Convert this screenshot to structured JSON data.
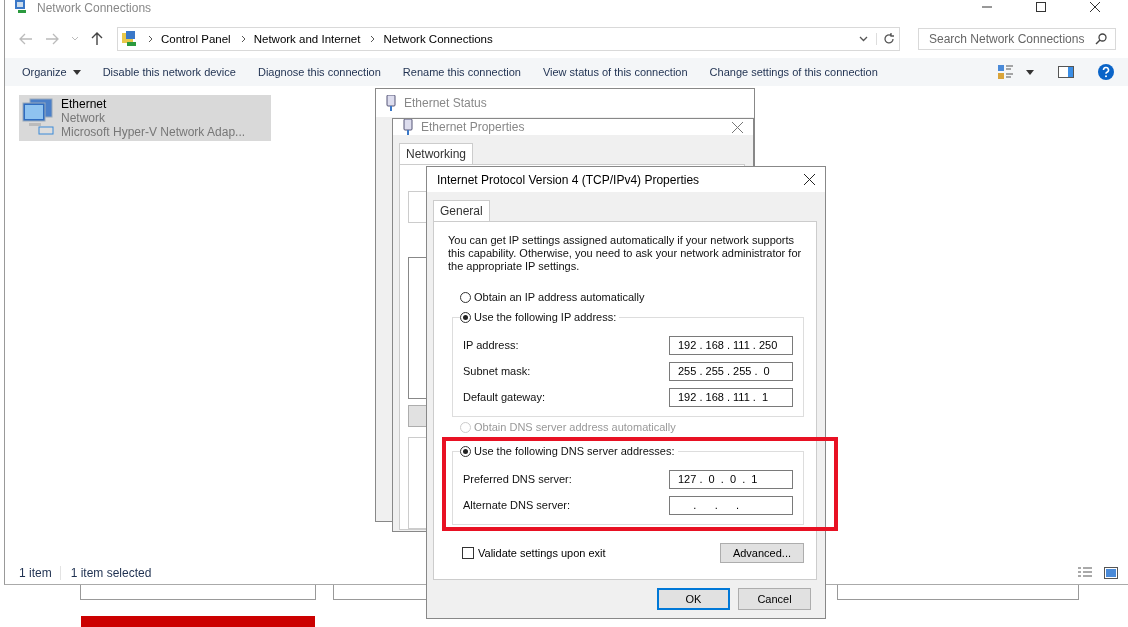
{
  "window": {
    "title": "Network Connections"
  },
  "address_bar": {
    "path": [
      "Control Panel",
      "Network and Internet",
      "Network Connections"
    ]
  },
  "search": {
    "placeholder": "Search Network Connections"
  },
  "toolbar": [
    {
      "label": "Organize",
      "dropdown": true
    },
    {
      "label": "Disable this network device",
      "dropdown": false
    },
    {
      "label": "Diagnose this connection",
      "dropdown": false
    },
    {
      "label": "Rename this connection",
      "dropdown": false
    },
    {
      "label": "View status of this connection",
      "dropdown": false
    },
    {
      "label": "Change settings of this connection",
      "dropdown": false
    }
  ],
  "connections": [
    {
      "name": "Ethernet",
      "network": "Network",
      "adapter": "Microsoft Hyper-V Network Adap...",
      "selected": true
    }
  ],
  "status_bar": {
    "count": "1 item",
    "selection": "1 item selected"
  },
  "status_dialog": {
    "title": "Ethernet Status"
  },
  "properties_dialog": {
    "title": "Ethernet Properties",
    "tabs": [
      {
        "label": "Networking",
        "selected": true
      }
    ]
  },
  "ipv4_dialog": {
    "title": "Internet Protocol Version 4 (TCP/IPv4) Properties",
    "tabs": [
      {
        "label": "General",
        "selected": true
      }
    ],
    "intro": "You can get IP settings assigned automatically if your network supports this capability. Otherwise, you need to ask your network administrator for the appropriate IP settings.",
    "ip_mode": [
      {
        "label": "Obtain an IP address automatically",
        "selected": false,
        "disabled": false
      },
      {
        "label": "Use the following IP address:",
        "selected": true,
        "disabled": false
      }
    ],
    "ip_fields": [
      {
        "label": "IP address:",
        "value": "192 . 168 . 111 . 250"
      },
      {
        "label": "Subnet mask:",
        "value": "255 . 255 . 255 .  0"
      },
      {
        "label": "Default gateway:",
        "value": "192 . 168 . 111 .  1"
      }
    ],
    "dns_mode": [
      {
        "label": "Obtain DNS server address automatically",
        "selected": false,
        "disabled": true
      },
      {
        "label": "Use the following DNS server addresses:",
        "selected": true,
        "disabled": false
      }
    ],
    "dns_fields": [
      {
        "label": "Preferred DNS server:",
        "value": "127 .  0  .  0  .  1"
      },
      {
        "label": "Alternate DNS server:",
        "value": "     .      .      .     "
      }
    ],
    "validate": {
      "label": "Validate settings upon exit",
      "checked": false
    },
    "advanced": "Advanced...",
    "buttons": [
      {
        "label": "OK",
        "default": true
      },
      {
        "label": "Cancel",
        "default": false
      }
    ]
  }
}
